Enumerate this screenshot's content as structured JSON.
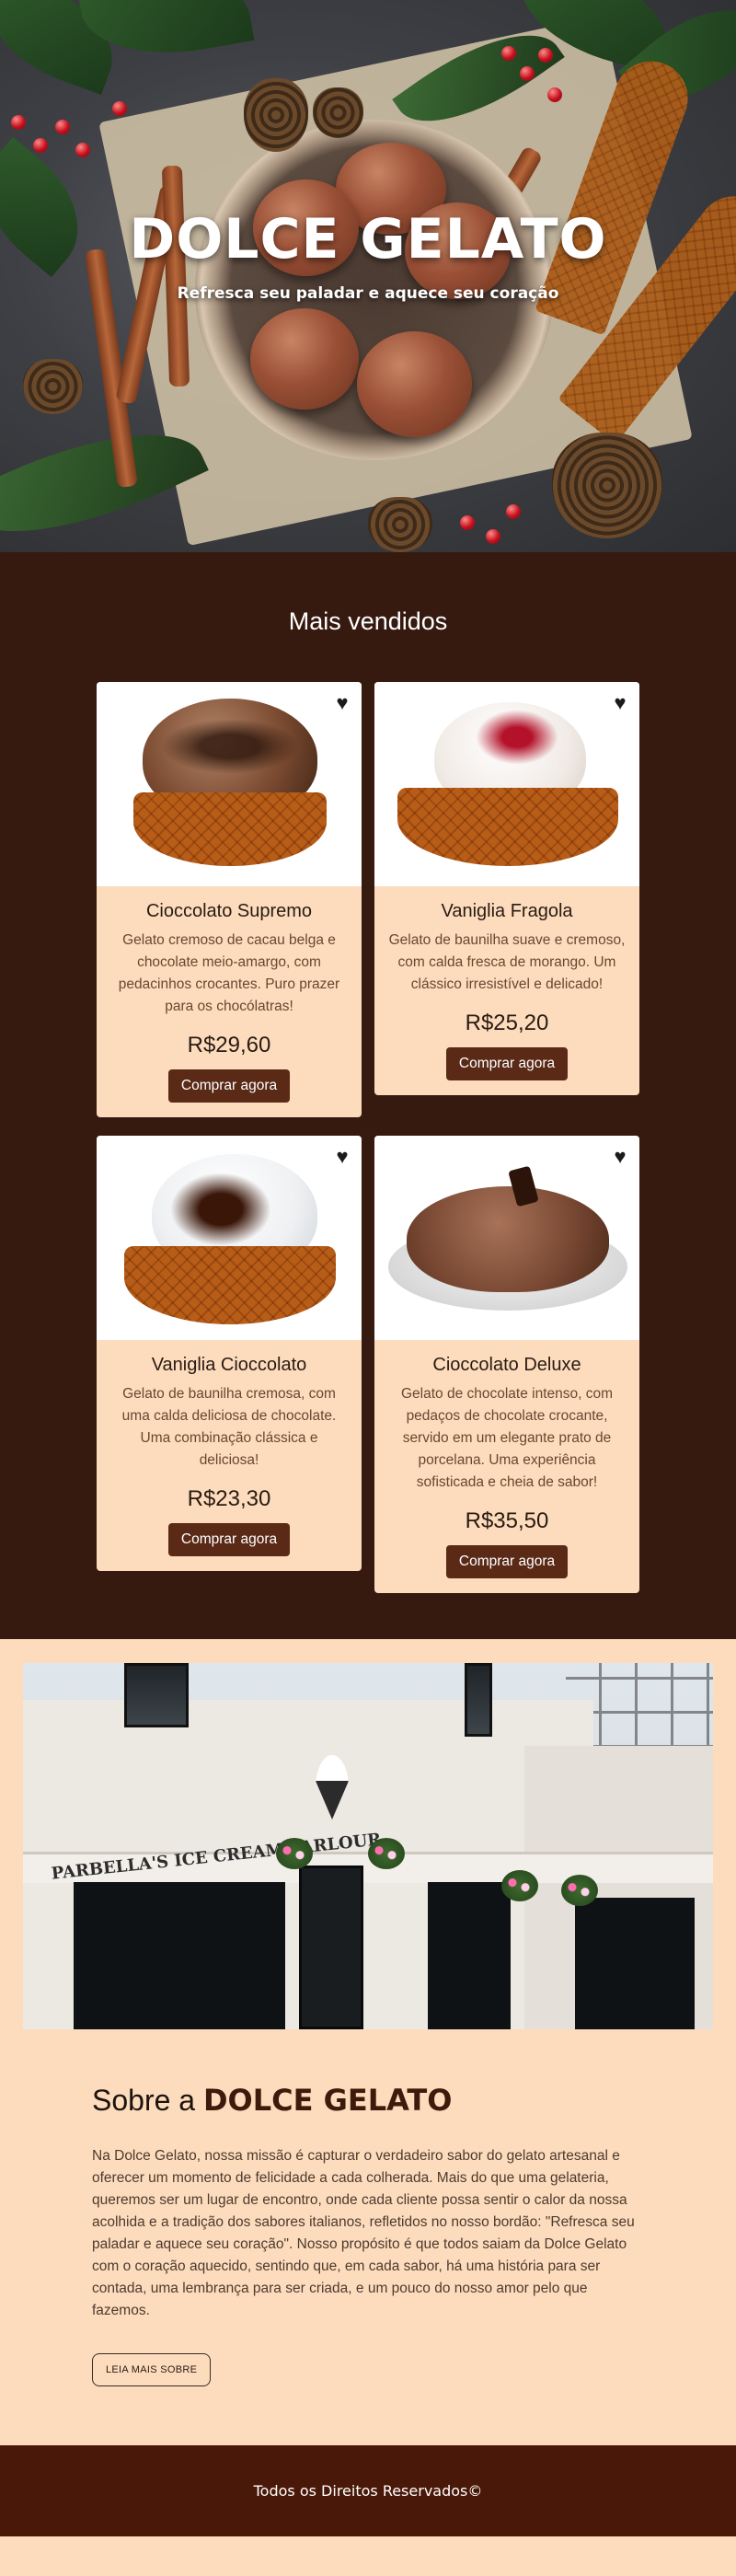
{
  "hero": {
    "title": "DOLCE GELATO",
    "subtitle": "Refresca seu paladar e aquece seu coração"
  },
  "best_sellers": {
    "heading": "Mais vendidos",
    "products": [
      {
        "name": "Cioccolato Supremo",
        "description": "Gelato cremoso de cacau belga e chocolate meio-amargo, com pedacinhos crocantes. Puro prazer para os chocólatras!",
        "price": "R$29,60",
        "button": "Comprar agora",
        "favorite_icon": "heart-icon"
      },
      {
        "name": "Vaniglia Fragola",
        "description": "Gelato de baunilha suave e cremoso, com calda fresca de morango. Um clássico irresistível e delicado!",
        "price": "R$25,20",
        "button": "Comprar agora",
        "favorite_icon": "heart-icon"
      },
      {
        "name": "Vaniglia Cioccolato",
        "description": "Gelato de baunilha cremosa, com uma calda deliciosa de chocolate. Uma combinação clássica e deliciosa!",
        "price": "R$23,30",
        "button": "Comprar agora",
        "favorite_icon": "heart-icon"
      },
      {
        "name": "Cioccolato Deluxe",
        "description": "Gelato de chocolate intenso, com pedaços de chocolate crocante, servido em um elegante prato de porcelana. Uma experiência sofisticada e cheia de sabor!",
        "price": "R$35,50",
        "button": "Comprar agora",
        "favorite_icon": "heart-icon"
      }
    ]
  },
  "store_photo": {
    "sign_text": "PARBELLA'S ICE CREAM PARLOUR"
  },
  "about": {
    "heading_prefix": "Sobre a ",
    "heading_brand": "DOLCE GELATO",
    "text": "Na Dolce Gelato, nossa missão é capturar o verdadeiro sabor do gelato artesanal e oferecer um momento de felicidade a cada colherada. Mais do que uma gelateria, queremos ser um lugar de encontro, onde cada cliente possa sentir o calor da nossa acolhida e a tradição dos sabores italianos, refletidos no nosso bordão: \"Refresca seu paladar e aquece seu coração\". Nosso propósito é que todos saiam da Dolce Gelato com o coração aquecido, sentindo que, em cada sabor, há uma história para ser contada, uma lembrança para ser criada, e um pouco do nosso amor pelo que fazemos.",
    "button": "LEIA MAIS SOBRE"
  },
  "footer": {
    "text": "Todos os Direitos Reservados©"
  },
  "colors": {
    "dark_brown": "#361a10",
    "footer_brown": "#4a1808",
    "cream": "#fcdcbd",
    "button_brown": "#5a2a17"
  }
}
